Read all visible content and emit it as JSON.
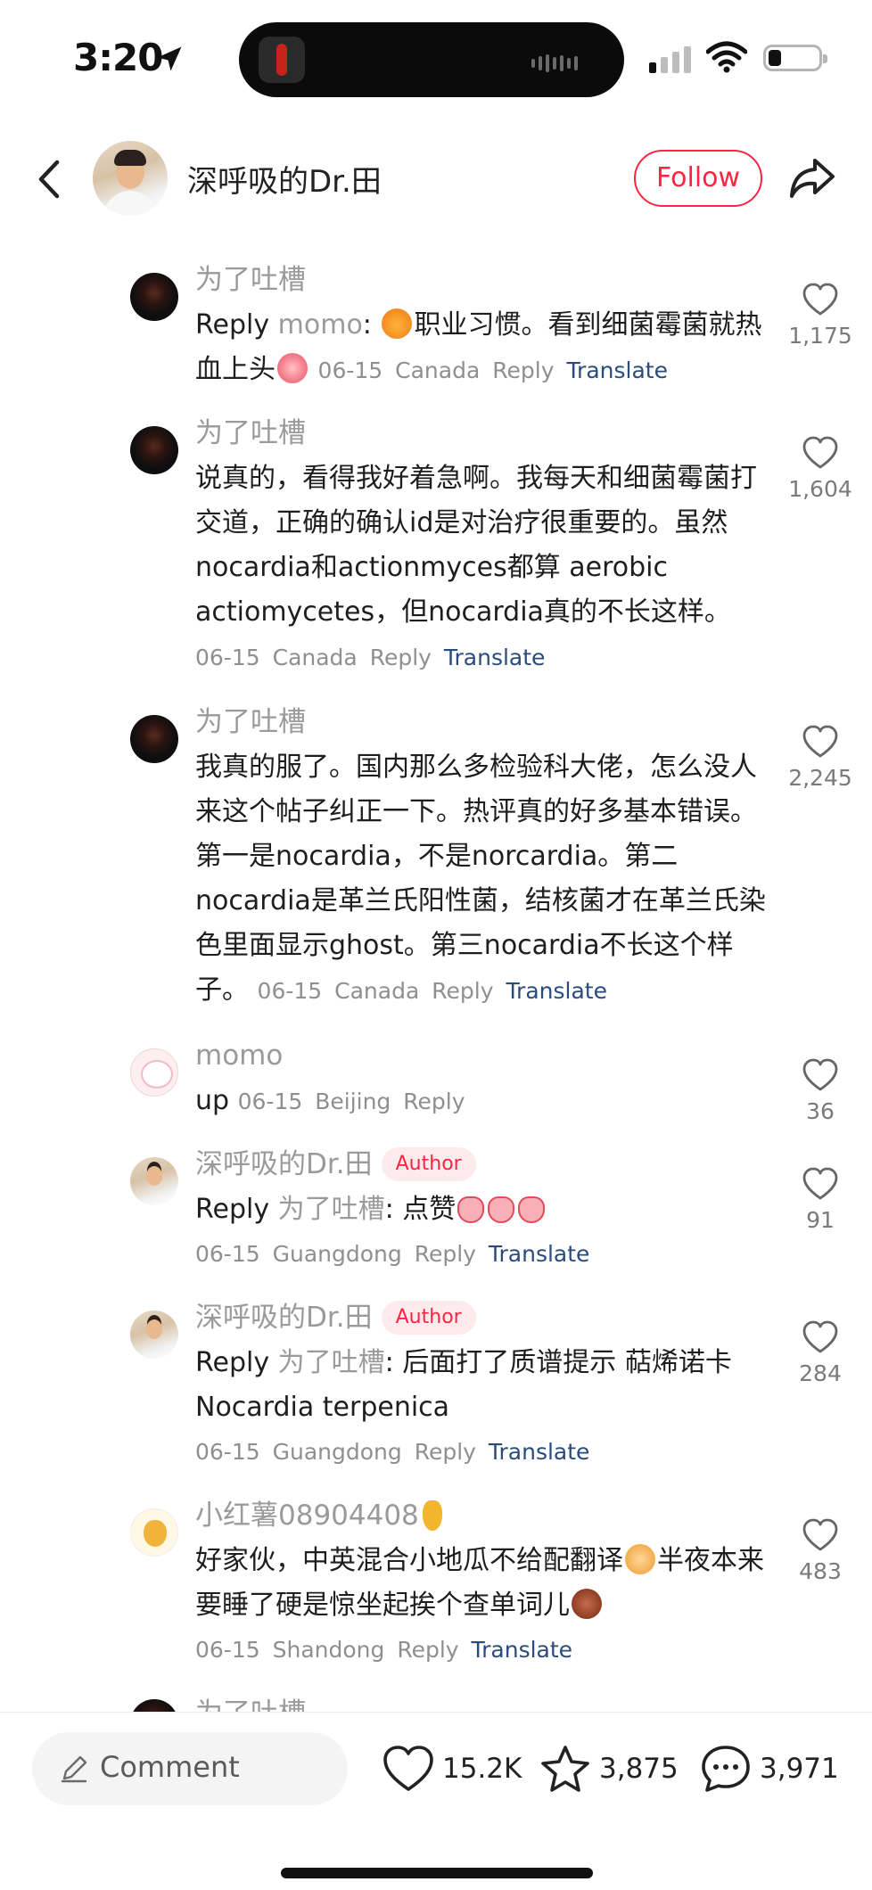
{
  "status_bar": {
    "time": "3:20"
  },
  "header": {
    "username": "深呼吸的Dr.田",
    "follow_label": "Follow"
  },
  "comments": [
    {
      "name": "为了吐槽",
      "author": "",
      "reply_prefix": "Reply",
      "reply_to": "momo",
      "text": ": ",
      "text2": "职业习惯。看到细菌霉菌就热血上头",
      "date": "06-15",
      "location": "Canada",
      "reply_label": "Reply",
      "translate_label": "Translate",
      "likes": "1,175"
    },
    {
      "name": "为了吐槽",
      "author": "",
      "reply_prefix": "",
      "reply_to": "",
      "text": "说真的，看得我好着急啊。我每天和细菌霉菌打交道，正确的确认id是对治疗很重要的。虽然nocardia和actionmyces都算 aerobic actiomycetes，但nocardia真的不长这样。",
      "text2": "",
      "date": "06-15",
      "location": "Canada",
      "reply_label": "Reply",
      "translate_label": "Translate",
      "likes": "1,604"
    },
    {
      "name": "为了吐槽",
      "author": "",
      "reply_prefix": "",
      "reply_to": "",
      "text": "我真的服了。国内那么多检验科大佬，怎么没人来这个帖子纠正一下。热评真的好多基本错误。第一是nocardia，不是norcardia。第二nocardia是革兰氏阳性菌，结核菌才在革兰氏染色里面显示ghost。第三nocardia不长这个样子。",
      "text2": "",
      "date": "06-15",
      "location": "Canada",
      "reply_label": "Reply",
      "translate_label": "Translate",
      "likes": "2,245"
    },
    {
      "name": "momo",
      "author": "",
      "reply_prefix": "",
      "reply_to": "",
      "text": "up",
      "text2": "",
      "date": "06-15",
      "location": "Beijing",
      "reply_label": "Reply",
      "translate_label": "",
      "likes": "36"
    },
    {
      "name": "深呼吸的Dr.田",
      "author": "Author",
      "reply_prefix": "Reply",
      "reply_to": "为了吐槽",
      "text": ": 点赞",
      "text2": "",
      "date": "06-15",
      "location": "Guangdong",
      "reply_label": "Reply",
      "translate_label": "Translate",
      "likes": "91"
    },
    {
      "name": "深呼吸的Dr.田",
      "author": "Author",
      "reply_prefix": "Reply",
      "reply_to": "为了吐槽",
      "text": ": 后面打了质谱提示 萜烯诺卡 Nocardia terpenica",
      "text2": "",
      "date": "06-15",
      "location": "Guangdong",
      "reply_label": "Reply",
      "translate_label": "Translate",
      "likes": "284"
    },
    {
      "name": "小红薯08904408",
      "author": "",
      "reply_prefix": "",
      "reply_to": "",
      "text": "好家伙，中英混合小地瓜不给配翻译",
      "text2": "半夜本来要睡了硬是惊坐起挨个查单词儿",
      "date": "06-15",
      "location": "Shandong",
      "reply_label": "Reply",
      "translate_label": "Translate",
      "likes": "483"
    },
    {
      "name": "为了吐槽",
      "author": "",
      "reply_prefix": "",
      "reply_to": "",
      "text": "",
      "text2": "",
      "date": "",
      "location": "",
      "reply_label": "",
      "translate_label": "",
      "likes": ""
    }
  ],
  "bottom_bar": {
    "comment_placeholder": "Comment",
    "likes": "15.2K",
    "favorites": "3,875",
    "comments": "3,971"
  },
  "colors": {
    "accent": "#ff2442",
    "translate": "#2a4c7c",
    "muted": "#9a9a9a"
  }
}
